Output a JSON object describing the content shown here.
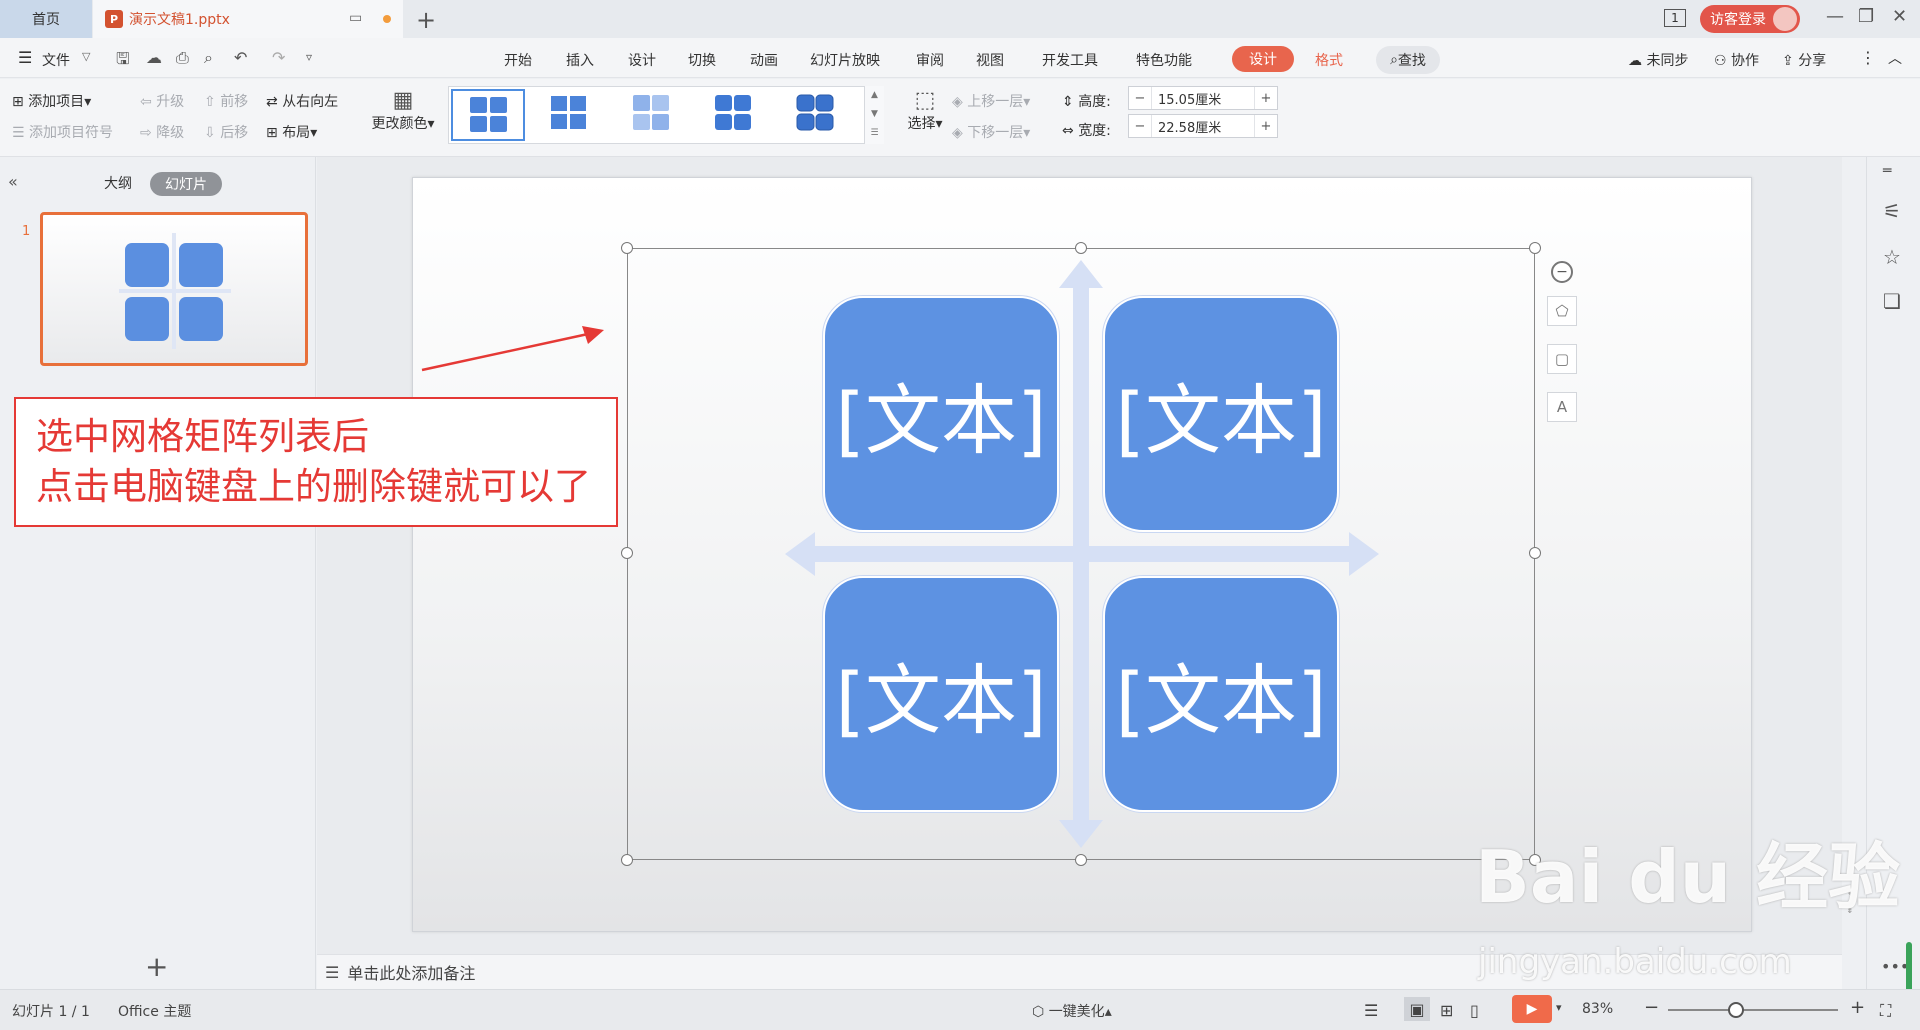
{
  "titlebar": {
    "home_tab": "首页",
    "doc_tab": "演示文稿1.pptx",
    "doc_badge": "P",
    "new_tab": "+",
    "page_indicator": "1",
    "login": "访客登录"
  },
  "menu": {
    "file": "文件",
    "items": [
      "开始",
      "插入",
      "设计",
      "切换",
      "动画",
      "幻灯片放映",
      "审阅",
      "视图",
      "开发工具",
      "特色功能"
    ],
    "active": "设计",
    "format": "格式",
    "search": "查找",
    "sync": "未同步",
    "collab": "协作",
    "share": "分享"
  },
  "ribbon": {
    "add_item": "添加项目",
    "add_bullet": "添加项目符号",
    "promote": "升级",
    "demote": "降级",
    "move_forward": "前移",
    "move_backward": "后移",
    "right_to_left": "从右向左",
    "layout": "布局",
    "change_color": "更改颜色",
    "select": "选择",
    "move_up": "上移一层",
    "move_down": "下移一层",
    "height_label": "高度:",
    "height_value": "15.05厘米",
    "width_label": "宽度:",
    "width_value": "22.58厘米"
  },
  "leftpanel": {
    "outline_tab": "大纲",
    "slides_tab": "幻灯片",
    "slide_number": "1",
    "add_slide": "+"
  },
  "slide": {
    "cells": [
      "[文本]",
      "[文本]",
      "[文本]",
      "[文本]"
    ]
  },
  "annotation": {
    "line1": "选中网格矩阵列表后",
    "line2": "点击电脑键盘上的删除键就可以了"
  },
  "notes": {
    "placeholder": "单击此处添加备注"
  },
  "status": {
    "slide_count": "幻灯片 1 / 1",
    "theme": "Office 主题",
    "beautify": "一键美化",
    "zoom": "83%"
  },
  "watermark": {
    "logo": "Bai du 经验",
    "url": "jingyan.baidu.com"
  },
  "colors": {
    "accent": "#e8654d",
    "quad": "#5d92e2",
    "annotation": "#e53935"
  }
}
